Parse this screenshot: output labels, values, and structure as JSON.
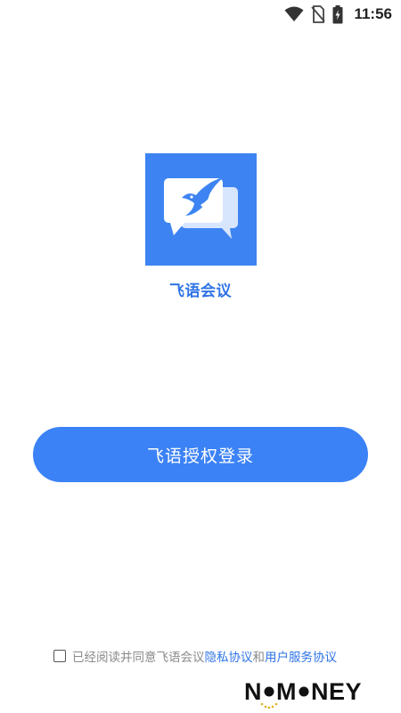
{
  "status_bar": {
    "time": "11:56",
    "icons": [
      "wifi-icon",
      "no-sim-icon",
      "battery-charging-icon"
    ]
  },
  "app": {
    "name": "飞语会议",
    "logo_icon": "bird-chat-bubble-logo",
    "brand_color": "#3d84f2"
  },
  "login": {
    "button_label": "飞语授权登录",
    "button_color": "#3b82f6"
  },
  "agreement": {
    "checked": false,
    "prefix_text": "已经阅读并同意飞语会议",
    "privacy_link": "隐私协议",
    "connector": "和",
    "service_link": "用户服务协议"
  },
  "watermark": {
    "text": "NOMONEY"
  }
}
